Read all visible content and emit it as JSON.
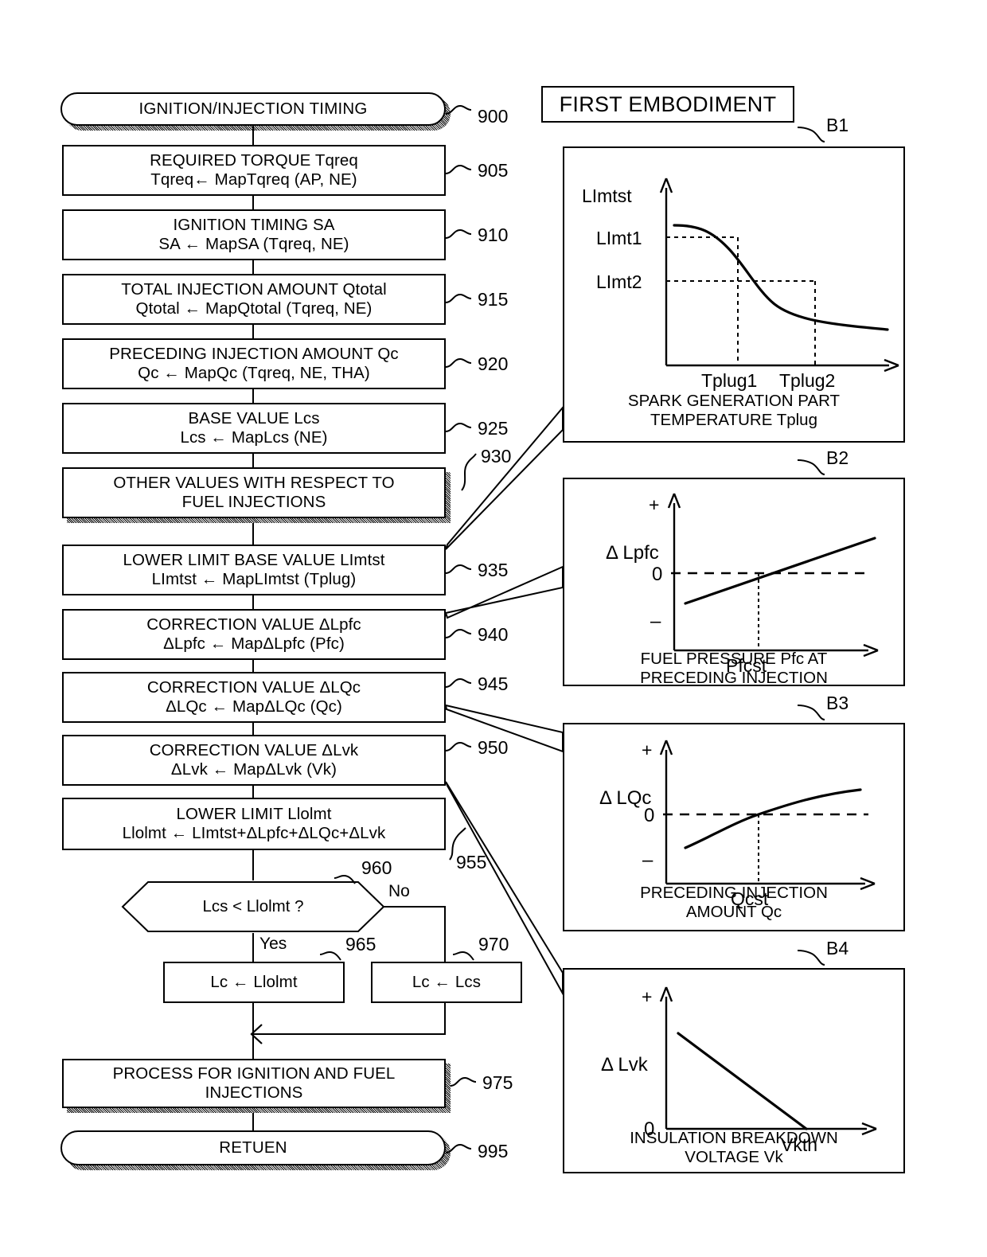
{
  "header": {
    "title": "FIRST EMBODIMENT"
  },
  "flowchart": {
    "start": {
      "label": "IGNITION/INJECTION TIMING",
      "ref": "900"
    },
    "steps": [
      {
        "ref": "905",
        "line1": "REQUIRED TORQUE Tqreq",
        "line2": "Tqreq← MapTqreq (AP, NE)"
      },
      {
        "ref": "910",
        "line1": "IGNITION TIMING SA",
        "line2": "SA  ←  MapSA (Tqreq, NE)"
      },
      {
        "ref": "915",
        "line1": "TOTAL INJECTION AMOUNT Qtotal",
        "line2": "Qtotal  ←  MapQtotal (Tqreq, NE)"
      },
      {
        "ref": "920",
        "line1": "PRECEDING INJECTION AMOUNT Qc",
        "line2": "Qc  ←  MapQc (Tqreq, NE, THA)"
      },
      {
        "ref": "925",
        "line1": "BASE VALUE Lcs",
        "line2": "Lcs  ←  MapLcs (NE)"
      },
      {
        "ref": "930",
        "line1": "OTHER VALUES WITH RESPECT TO",
        "line2": "FUEL INJECTIONS",
        "shadow": true
      },
      {
        "ref": "935",
        "line1": "LOWER LIMIT BASE VALUE LImtst",
        "line2": "LImtst  ←  MapLImtst (Tplug)"
      },
      {
        "ref": "940",
        "line1": "CORRECTION VALUE ΔLpfc",
        "line2": "ΔLpfc  ←  MapΔLpfc (Pfc)"
      },
      {
        "ref": "945",
        "line1": "CORRECTION VALUE ΔLQc",
        "line2": "ΔLQc  ←  MapΔLQc (Qc)"
      },
      {
        "ref": "950",
        "line1": "CORRECTION VALUE ΔLvk",
        "line2": "ΔLvk  ←  MapΔLvk (Vk)"
      },
      {
        "ref": "955",
        "line1": "LOWER LIMIT Llolmt",
        "line2": "Llolmt  ←  LImtst+ΔLpfc+ΔLQc+ΔLvk"
      }
    ],
    "decision": {
      "ref": "960",
      "label": "Lcs  <  Llolmt  ?",
      "yes": "Yes",
      "no": "No"
    },
    "branch_yes": {
      "ref": "965",
      "label": "Lc  ←  Llolmt"
    },
    "branch_no": {
      "ref": "970",
      "label": "Lc  ←  Lcs"
    },
    "process": {
      "ref": "975",
      "line1": "PROCESS FOR IGNITION AND FUEL",
      "line2": "INJECTIONS"
    },
    "end": {
      "label": "RETUEN",
      "ref": "995"
    }
  },
  "chart_data": [
    {
      "id": "B1",
      "type": "line",
      "title": "",
      "ylabel": "LImtst",
      "xlabel": "SPARK GENERATION PART\nTEMPERATURE Tplug",
      "ytick_labels": [
        "LImt1",
        "LImt2"
      ],
      "xtick_labels": [
        "Tplug1",
        "Tplug2"
      ],
      "x": [
        0,
        0.1,
        0.2,
        0.3,
        0.4,
        0.5,
        0.6,
        0.7,
        0.8,
        0.9,
        1.0
      ],
      "values": [
        0.915,
        0.905,
        0.88,
        0.835,
        0.76,
        0.665,
        0.565,
        0.47,
        0.4,
        0.355,
        0.335
      ],
      "markers": [
        {
          "x": 0.3,
          "y": 0.835,
          "xlabel": "Tplug1",
          "ylabel": "LImt1"
        },
        {
          "x": 0.7,
          "y": 0.47,
          "xlabel": "Tplug2",
          "ylabel": "LImt2"
        }
      ],
      "grid": false,
      "note": "monotonically decreasing S-curve"
    },
    {
      "id": "B2",
      "type": "line",
      "ylabel": "Δ Lpfc",
      "xlabel": "FUEL PRESSURE Pfc AT\nPRECEDING INJECTION",
      "ytick_labels": [
        "+",
        "0",
        "−"
      ],
      "xtick_labels": [
        "Pfcst"
      ],
      "x": [
        0.08,
        1.0
      ],
      "values": [
        -0.33,
        0.62
      ],
      "zero_line": true,
      "markers": [
        {
          "x": 0.5,
          "y": 0.0,
          "xlabel": "Pfcst"
        }
      ],
      "grid": false,
      "note": "straight increasing line crossing 0 at Pfcst"
    },
    {
      "id": "B3",
      "type": "line",
      "ylabel": "Δ LQc",
      "xlabel": "PRECEDING INJECTION\nAMOUNT Qc",
      "ytick_labels": [
        "+",
        "0",
        "−"
      ],
      "xtick_labels": [
        "Qcst"
      ],
      "x": [
        0.1,
        0.2,
        0.3,
        0.4,
        0.5,
        0.6,
        0.7,
        0.8,
        0.9,
        1.0
      ],
      "values": [
        -0.46,
        -0.34,
        -0.23,
        -0.12,
        0.0,
        0.09,
        0.18,
        0.25,
        0.31,
        0.36
      ],
      "zero_line": true,
      "markers": [
        {
          "x": 0.5,
          "y": 0.0,
          "xlabel": "Qcst"
        }
      ],
      "grid": false,
      "note": "concave increasing curve crossing 0 at Qcst"
    },
    {
      "id": "B4",
      "type": "line",
      "ylabel": "Δ Lvk",
      "xlabel": "INSULATION BREAKDOWN\nVOLTAGE Vk",
      "ytick_labels": [
        "+",
        "0"
      ],
      "xtick_labels": [
        "Vkth"
      ],
      "x": [
        0.08,
        0.72
      ],
      "values": [
        0.72,
        0.0
      ],
      "markers": [
        {
          "x": 0.72,
          "y": 0.0,
          "xlabel": "Vkth"
        }
      ],
      "grid": false,
      "note": "straight decreasing line reaching 0 at Vkth"
    }
  ]
}
